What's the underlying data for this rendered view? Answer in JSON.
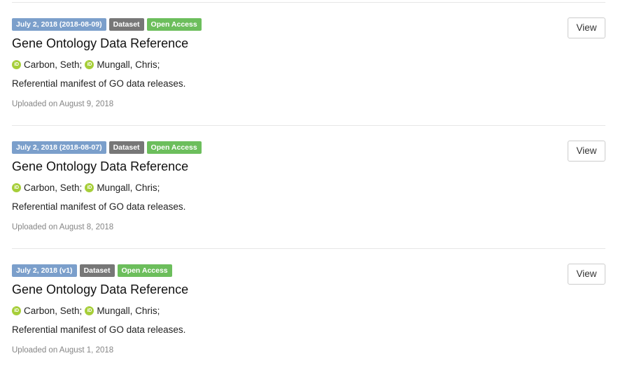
{
  "records": [
    {
      "date_badge": "July 2, 2018 (2018-08-09)",
      "type_badge": "Dataset",
      "access_badge": "Open Access",
      "title": "Gene Ontology Data Reference",
      "authors": [
        "Carbon, Seth;",
        "Mungall, Chris;"
      ],
      "description": "Referential manifest of GO data releases.",
      "uploaded": "Uploaded on August 9, 2018",
      "view_label": "View"
    },
    {
      "date_badge": "July 2, 2018 (2018-08-07)",
      "type_badge": "Dataset",
      "access_badge": "Open Access",
      "title": "Gene Ontology Data Reference",
      "authors": [
        "Carbon, Seth;",
        "Mungall, Chris;"
      ],
      "description": "Referential manifest of GO data releases.",
      "uploaded": "Uploaded on August 8, 2018",
      "view_label": "View"
    },
    {
      "date_badge": "July 2, 2018 (v1)",
      "type_badge": "Dataset",
      "access_badge": "Open Access",
      "title": "Gene Ontology Data Reference",
      "authors": [
        "Carbon, Seth;",
        "Mungall, Chris;"
      ],
      "description": "Referential manifest of GO data releases.",
      "uploaded": "Uploaded on August 1, 2018",
      "view_label": "View"
    }
  ],
  "icons": {
    "orcid": {
      "name": "orcid-icon",
      "glyph": "iD",
      "color": "#a6ce39"
    }
  },
  "colors": {
    "date_badge": "#7b9fcb",
    "type_badge": "#777777",
    "access_badge": "#6cbe5c"
  }
}
